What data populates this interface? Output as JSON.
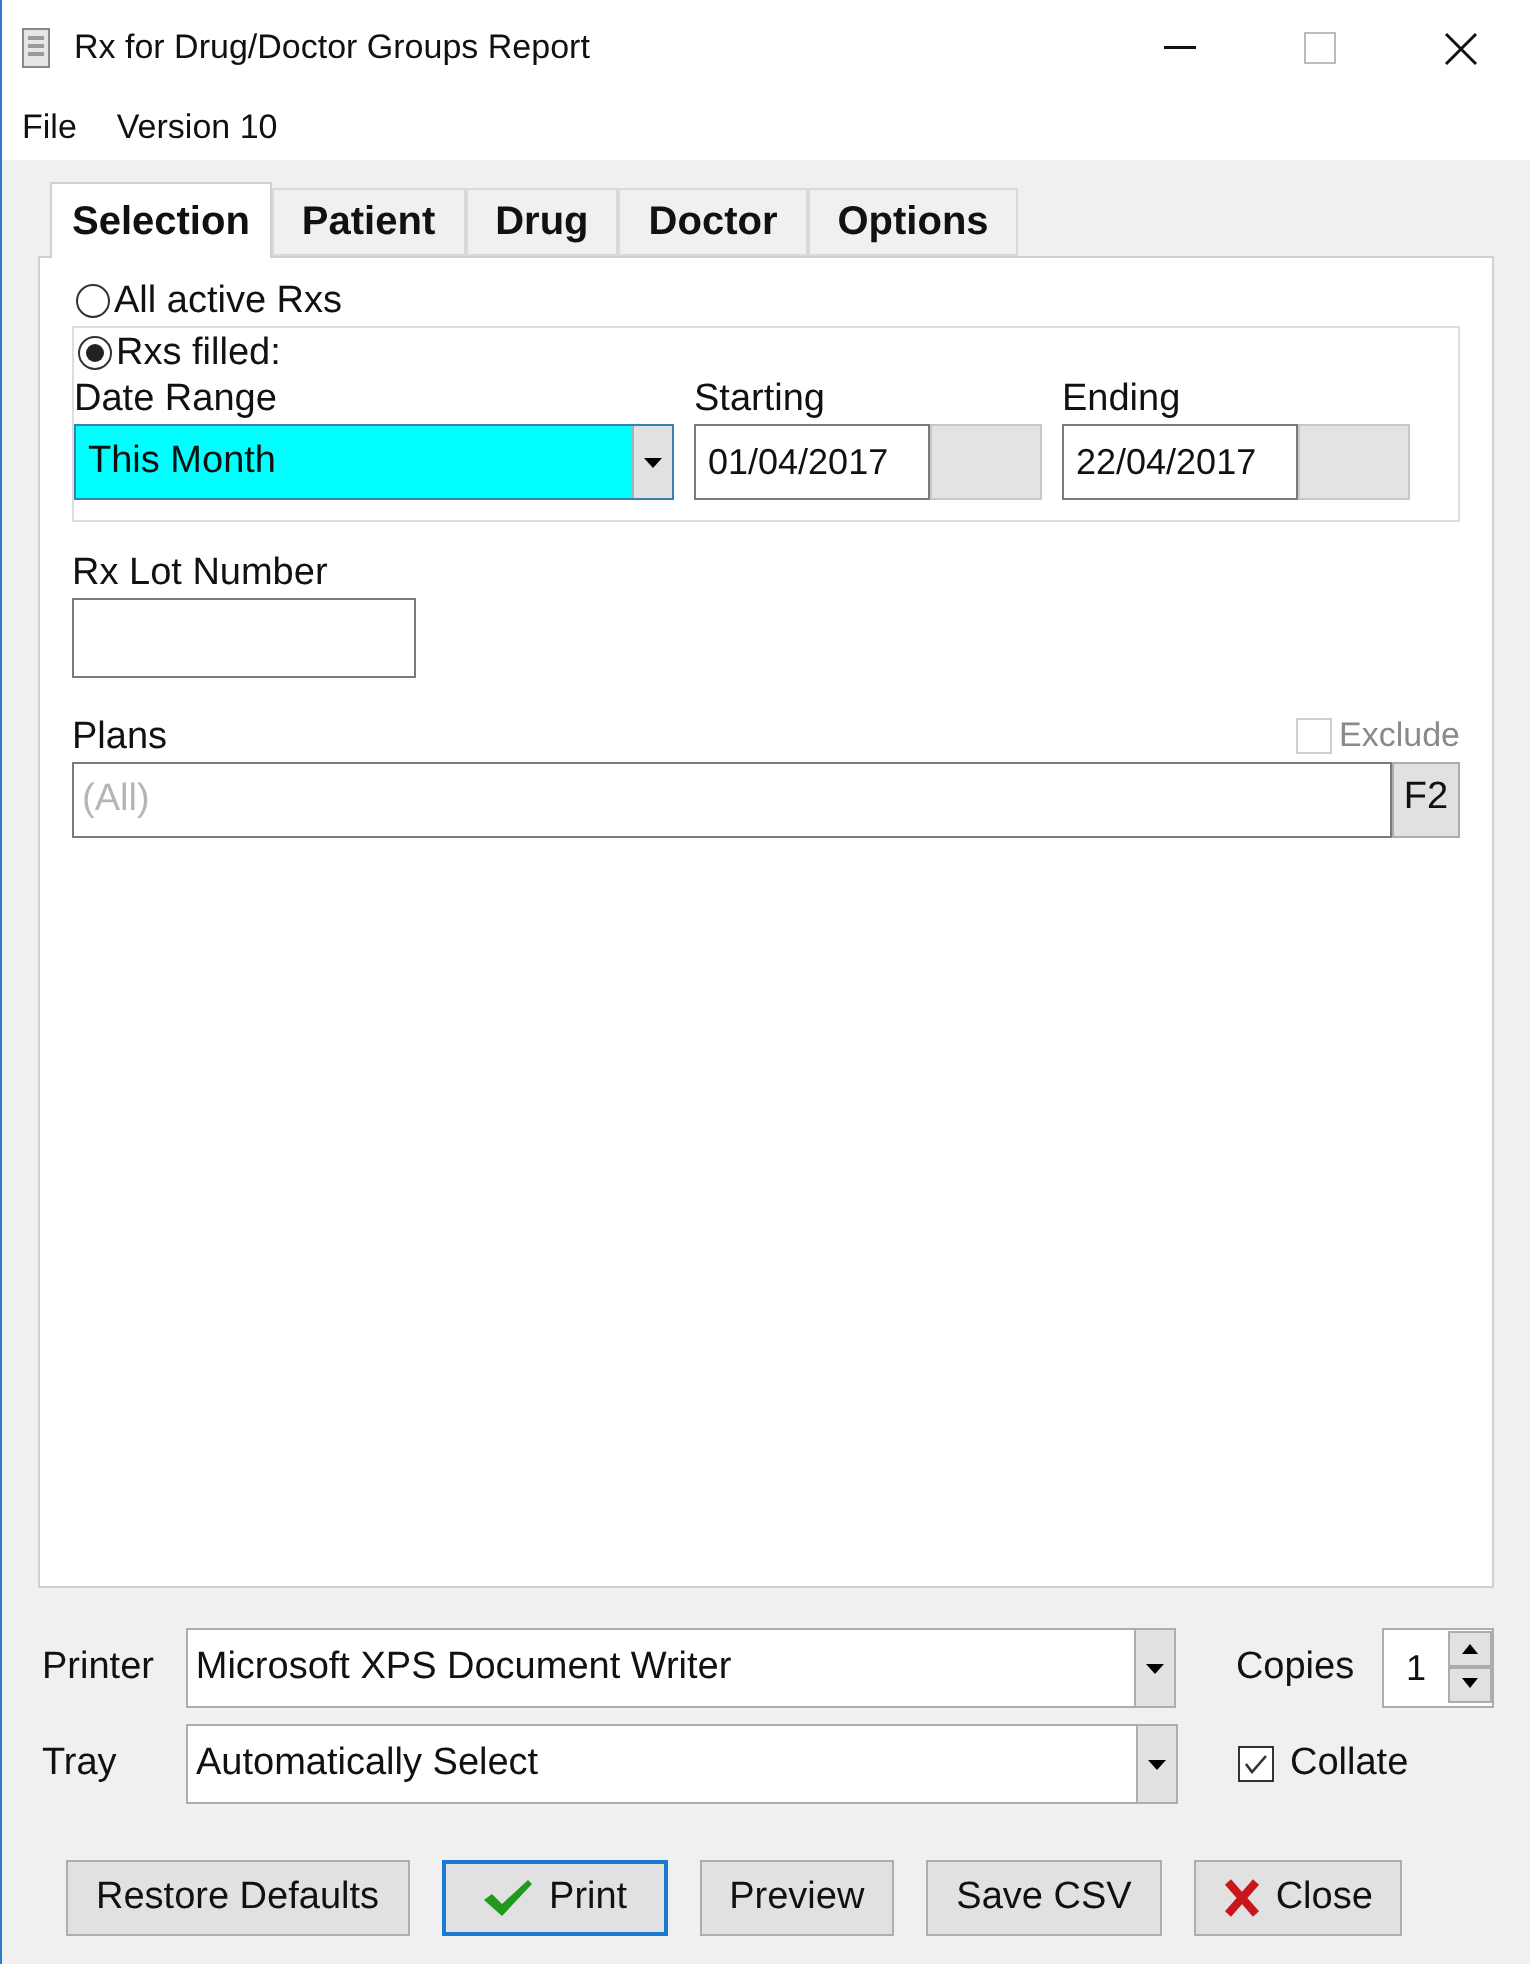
{
  "window": {
    "title": "Rx for Drug/Doctor Groups Report"
  },
  "menu": [
    "File",
    "Version 10"
  ],
  "tabs": [
    {
      "label": "Selection",
      "selected": true
    },
    {
      "label": "Patient",
      "selected": false
    },
    {
      "label": "Drug",
      "selected": false
    },
    {
      "label": "Doctor",
      "selected": false
    },
    {
      "label": "Options",
      "selected": false
    }
  ],
  "scope": [
    {
      "label": "All active Rxs",
      "selected": false
    },
    {
      "label": "Rxs filled:",
      "selected": true
    }
  ],
  "date_range": {
    "label": "Date Range",
    "value": "This Month"
  },
  "starting": {
    "label": "Starting",
    "value": "01/04/2017"
  },
  "ending": {
    "label": "Ending",
    "value": "22/04/2017"
  },
  "lot": {
    "label": "Rx Lot Number"
  },
  "plans": {
    "label": "Plans",
    "placeholder": "(All)",
    "exclude": {
      "label": "Exclude",
      "checked": false,
      "disabled": true
    },
    "button": "F2"
  },
  "printer": {
    "label": "Printer",
    "value": "Microsoft XPS Document Writer"
  },
  "tray": {
    "label": "Tray",
    "value": "Automatically Select"
  },
  "copies": {
    "label": "Copies",
    "value": "1"
  },
  "collate": {
    "label": "Collate",
    "checked": true
  },
  "buttons": [
    {
      "label": "Restore Defaults",
      "kind": "plain"
    },
    {
      "label": "Print",
      "kind": "check"
    },
    {
      "label": "Preview",
      "kind": "plain"
    },
    {
      "label": "Save CSV",
      "kind": "plain"
    },
    {
      "label": "Close",
      "kind": "cross"
    }
  ]
}
